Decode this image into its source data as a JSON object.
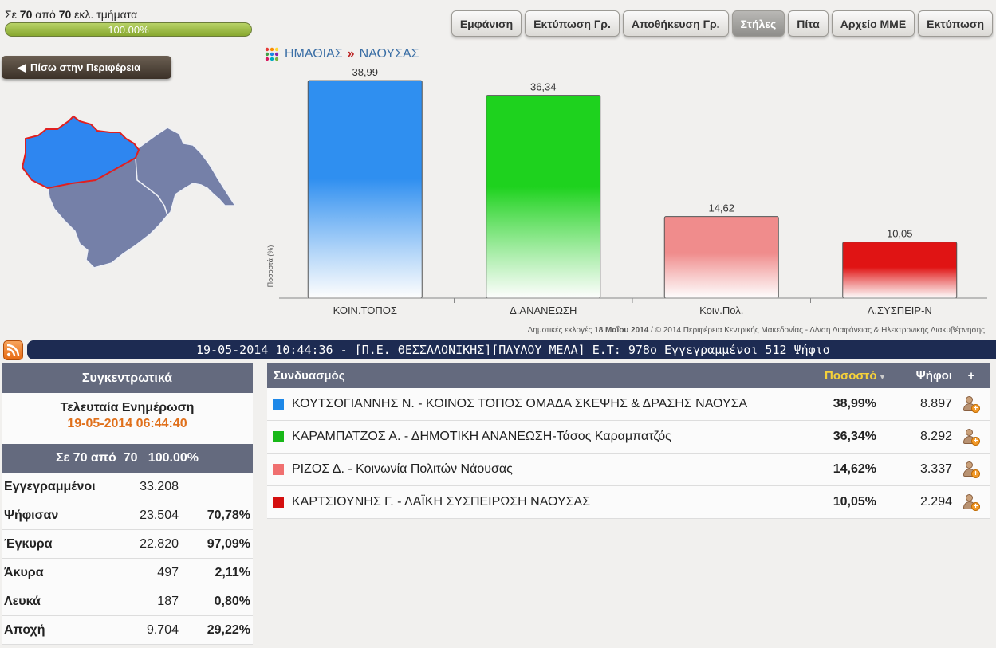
{
  "progress": {
    "prefix": "Σε",
    "done": "70",
    "mid": "από",
    "total": "70",
    "suffix": "εκλ. τμήματα",
    "percent_text": "100.00%",
    "fraction": 1.0
  },
  "toolbar": [
    "Εμφάνιση",
    "Εκτύπωση Γρ.",
    "Αποθήκευση Γρ.",
    "Στήλες",
    "Πίτα",
    "Αρχείο ΜΜΕ",
    "Εκτύπωση"
  ],
  "toolbar_active": "Στήλες",
  "back_button": "Πίσω στην Περιφέρεια",
  "breadcrumb": {
    "region": "ΗΜΑΘΙΑΣ",
    "separator": "»",
    "municipality": "ΝΑΟΥΣΑΣ"
  },
  "chart_data": {
    "type": "bar",
    "categories": [
      "ΚΟΙΝ.ΤΟΠΟΣ",
      "Δ.ΑΝΑΝΕΩΣΗ",
      "Κοιν.Πολ.",
      "Λ.ΣΥΣΠΕΙΡ-Ν"
    ],
    "values": [
      38.99,
      36.34,
      14.62,
      10.05
    ],
    "value_labels": [
      "38,99",
      "36,34",
      "14,62",
      "10,05"
    ],
    "colors": [
      "#2f8ff0",
      "#1ed21e",
      "#f08c8c",
      "#e01414"
    ],
    "ylabel": "Ποσοστά (%)",
    "ylim": [
      0,
      40
    ],
    "grid": false
  },
  "chart_footer": {
    "prefix": "Δημοτικές εκλογές ",
    "date": "18 Μαΐου 2014",
    "rest": " / © 2014 Περιφέρεια Κεντρικής Μακεδονίας - Δ/νση Διαφάνειας & Ηλεκτρονικής Διακυβέρνησης"
  },
  "ticker": "19-05-2014 10:44:36 - [Π.Ε. ΘΕΣΣΑΛΟΝΙΚΗΣ][ΠΑΥΛΟΥ ΜΕΛΑ] Ε.Τ: 978ο Εγγεγραμμένοι 512 Ψήφισ",
  "summary": {
    "title": "Συγκεντρωτικά",
    "last_update_label": "Τελευταία Ενημέρωση",
    "last_update": "19-05-2014 06:44:40",
    "coverage": "Σε 70 από  70   100.00%",
    "rows": [
      {
        "label": "Εγγεγραμμένοι",
        "value": "33.208",
        "pct": ""
      },
      {
        "label": "Ψήφισαν",
        "value": "23.504",
        "pct": "70,78%"
      },
      {
        "label": "Έγκυρα",
        "value": "22.820",
        "pct": "97,09%"
      },
      {
        "label": "Άκυρα",
        "value": "497",
        "pct": "2,11%"
      },
      {
        "label": "Λευκά",
        "value": "187",
        "pct": "0,80%"
      },
      {
        "label": "Αποχή",
        "value": "9.704",
        "pct": "29,22%"
      }
    ]
  },
  "results": {
    "headers": {
      "combination": "Συνδυασμός",
      "percent": "Ποσοστό",
      "votes": "Ψήφοι",
      "plus": "+"
    },
    "rows": [
      {
        "color": "#1e88e8",
        "name": "ΚΟΥΤΣΟΓΙΑΝΝΗΣ Ν. - ΚΟΙΝΟΣ ΤΟΠΟΣ ΟΜΑΔΑ ΣΚΕΨΗΣ & ΔΡΑΣΗΣ ΝΑΟΥΣΑ",
        "pct": "38,99%",
        "votes": "8.897"
      },
      {
        "color": "#18b818",
        "name": "ΚΑΡΑΜΠΑΤΖΟΣ Α. - ΔΗΜΟΤΙΚΗ ΑΝΑΝΕΩΣΗ-Τάσος Καραμπατζός",
        "pct": "36,34%",
        "votes": "8.292"
      },
      {
        "color": "#f07070",
        "name": "ΡΙΖΟΣ Δ. - Κοινωνία Πολιτών Νάουσας",
        "pct": "14,62%",
        "votes": "3.337"
      },
      {
        "color": "#d40f0f",
        "name": "ΚΑΡΤΣΙΟΥΝΗΣ Γ. - ΛΑΪΚΗ ΣΥΣΠΕΙΡΩΣΗ ΝΑΟΥΣΑΣ",
        "pct": "10,05%",
        "votes": "2.294"
      }
    ]
  }
}
